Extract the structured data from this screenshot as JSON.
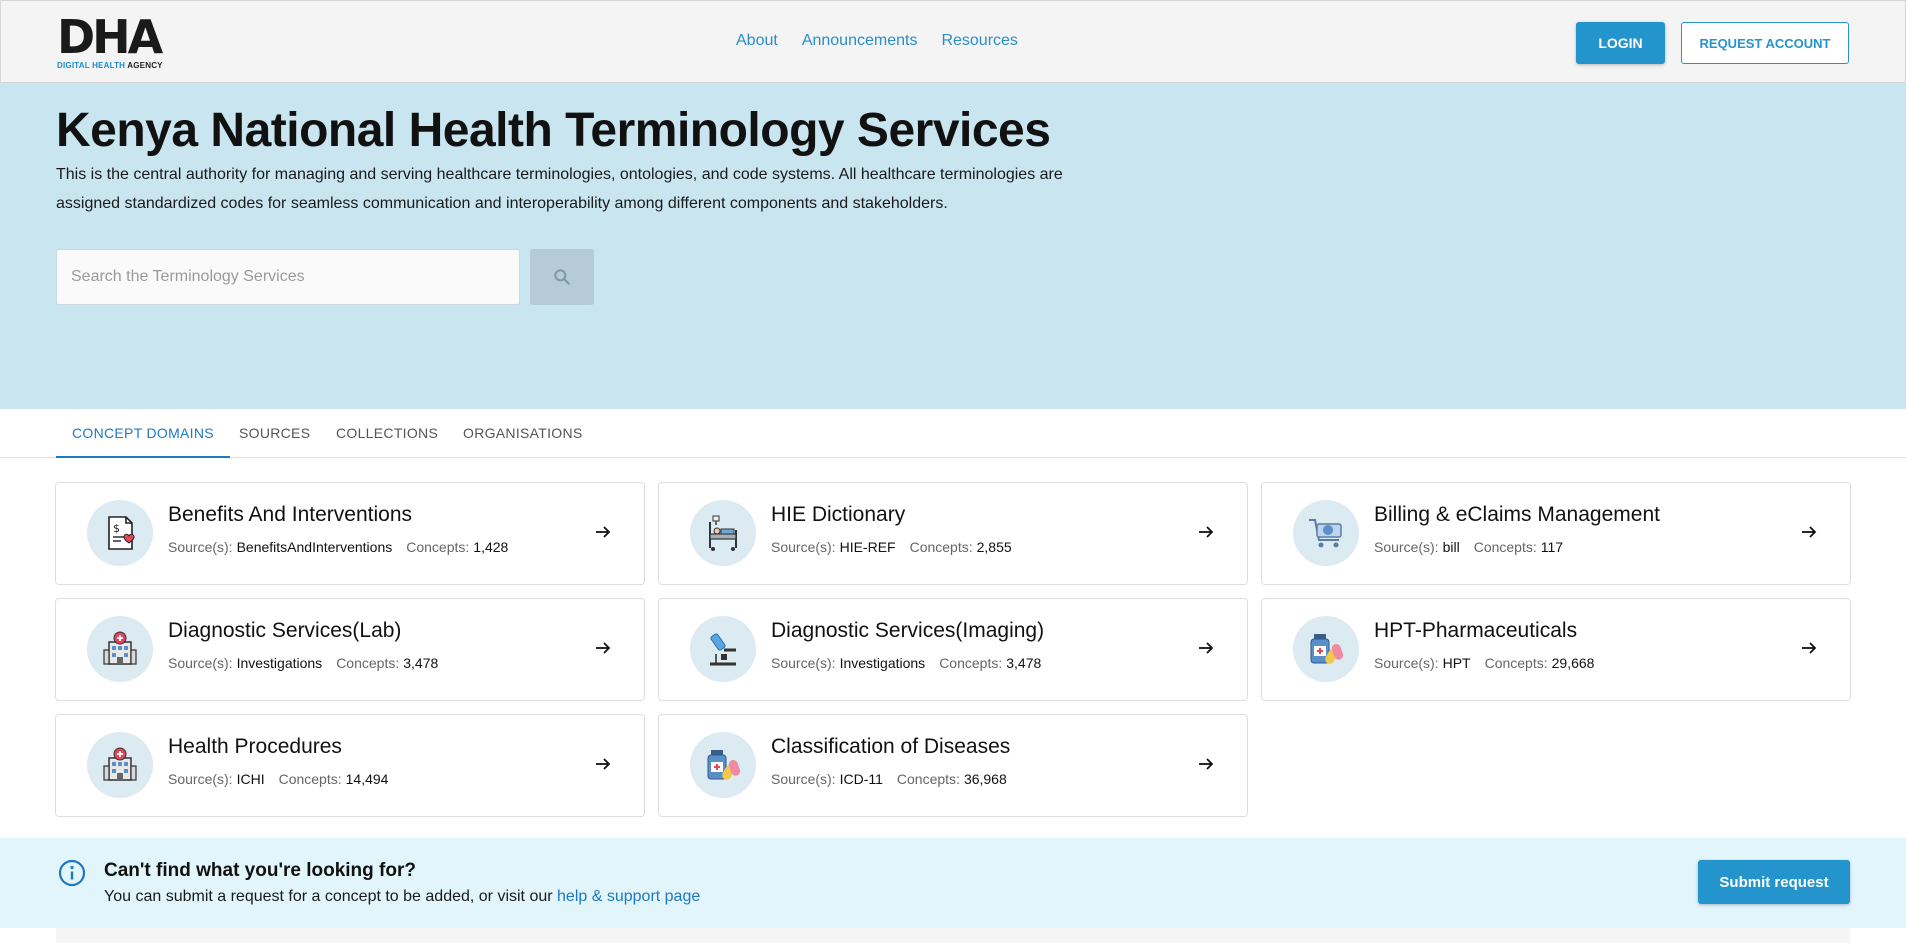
{
  "header": {
    "logo_text": "DHA",
    "logo_sub_blue": "DIGITAL HEALTH",
    "logo_sub_dark": "AGENCY",
    "nav": [
      "About",
      "Announcements",
      "Resources"
    ],
    "login_label": "LOGIN",
    "request_label": "REQUEST ACCOUNT"
  },
  "hero": {
    "title": "Kenya National Health Terminology Services",
    "description": "This is the central authority for managing and serving healthcare terminologies, ontologies, and code systems. All healthcare terminologies are assigned standardized codes for seamless communication and interoperability among different components and stakeholders.",
    "search_placeholder": "Search the Terminology Services"
  },
  "tabs": [
    "CONCEPT DOMAINS",
    "SOURCES",
    "COLLECTIONS",
    "ORGANISATIONS"
  ],
  "labels": {
    "sources": "Source(s):",
    "concepts": "Concepts:"
  },
  "cards": [
    {
      "title": "Benefits And Interventions",
      "source": "BenefitsAndInterventions",
      "concepts": "1,428",
      "icon": "invoice-heart-icon"
    },
    {
      "title": "HIE Dictionary",
      "source": "HIE-REF",
      "concepts": "2,855",
      "icon": "hospital-bed-icon"
    },
    {
      "title": "Billing & eClaims Management",
      "source": "bill",
      "concepts": "117",
      "icon": "cart-icon"
    },
    {
      "title": "Diagnostic Services(Lab)",
      "source": "Investigations",
      "concepts": "3,478",
      "icon": "hospital-building-icon"
    },
    {
      "title": "Diagnostic Services(Imaging)",
      "source": "Investigations",
      "concepts": "3,478",
      "icon": "microscope-icon"
    },
    {
      "title": "HPT-Pharmaceuticals",
      "source": "HPT",
      "concepts": "29,668",
      "icon": "pills-icon"
    },
    {
      "title": "Health Procedures",
      "source": "ICHI",
      "concepts": "14,494",
      "icon": "hospital-building-icon"
    },
    {
      "title": "Classification of Diseases",
      "source": "ICD-11",
      "concepts": "36,968",
      "icon": "pills-icon"
    }
  ],
  "info": {
    "title": "Can't find what you're looking for?",
    "text": "You can submit a request for a concept to be added, or visit our",
    "link": "help & support page",
    "submit_label": "Submit request"
  },
  "colors": {
    "accent": "#2394cc",
    "hero_bg": "#c8e5f0",
    "info_bg": "#e1f5fb",
    "tab_active": "#1f78c4"
  }
}
